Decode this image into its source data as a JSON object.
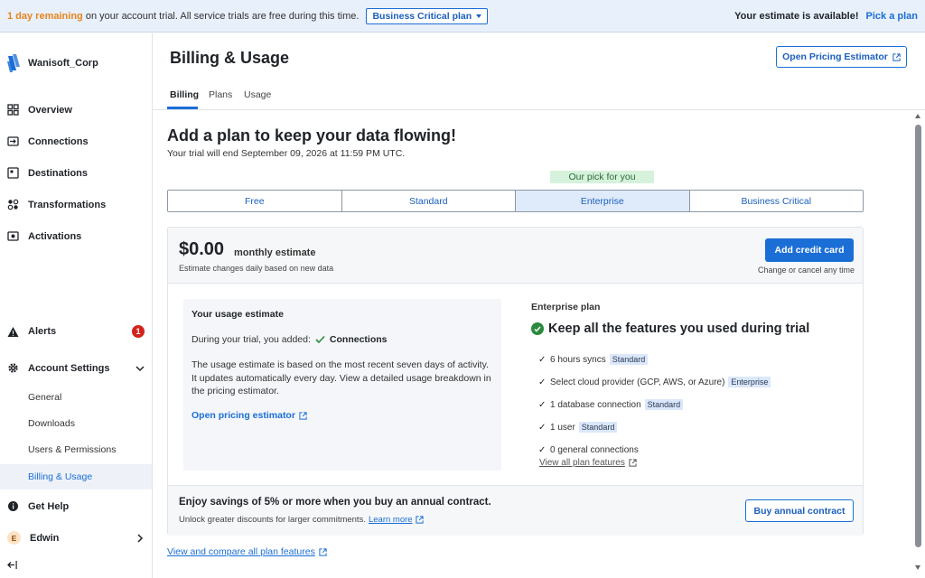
{
  "banner": {
    "days_remaining": "1 day remaining",
    "trial_text": " on your account trial. All service trials are free during this time.",
    "plan_select": "Business Critical plan",
    "estimate_text": "Your estimate is available!",
    "pick_plan": "Pick a plan"
  },
  "sidebar": {
    "org_name": "Wanisoft_Corp",
    "items": [
      {
        "label": "Overview",
        "icon": "grid-icon"
      },
      {
        "label": "Connections",
        "icon": "connections-icon"
      },
      {
        "label": "Destinations",
        "icon": "destinations-icon"
      },
      {
        "label": "Transformations",
        "icon": "transformations-icon"
      },
      {
        "label": "Activations",
        "icon": "activations-icon"
      }
    ],
    "alerts_label": "Alerts",
    "alerts_count": "1",
    "account_settings_label": "Account Settings",
    "sub_items": [
      "General",
      "Downloads",
      "Users & Permissions",
      "Billing & Usage"
    ],
    "help_label": "Get Help",
    "user_initial": "E",
    "user_name": "Edwin"
  },
  "header": {
    "title": "Billing & Usage",
    "pricing_button": "Open Pricing Estimator"
  },
  "tabs": [
    "Billing",
    "Plans",
    "Usage"
  ],
  "main": {
    "headline": "Add a plan to keep your data flowing!",
    "trial_end": "Your trial will end September 09, 2026 at 11:59 PM UTC.",
    "our_pick": "Our pick for you",
    "plans": [
      "Free",
      "Standard",
      "Enterprise",
      "Business Critical"
    ],
    "selected_plan": "Enterprise"
  },
  "estimate": {
    "price": "$0.00",
    "monthly": "monthly estimate",
    "note": "Estimate changes daily based on new data",
    "add_card": "Add credit card",
    "cancel_note": "Change or cancel any time"
  },
  "usage": {
    "title": "Your usage estimate",
    "added_prefix": "During your trial, you added:",
    "added_item": "Connections",
    "description": "The usage estimate is based on the most recent seven days of activity. It updates automatically every day. View a detailed usage breakdown in the pricing estimator.",
    "link": "Open pricing estimator"
  },
  "enterprise": {
    "label": "Enterprise plan",
    "headline": "Keep all the features you used during trial",
    "features": [
      {
        "text": "6 hours syncs",
        "tag": "Standard"
      },
      {
        "text": "Select cloud provider (GCP, AWS, or Azure)",
        "tag": "Enterprise"
      },
      {
        "text": "1 database connection",
        "tag": "Standard"
      },
      {
        "text": "1 user",
        "tag": "Standard"
      },
      {
        "text": "0 general connections",
        "tag": ""
      }
    ],
    "view_all": "View all plan features"
  },
  "annual": {
    "title": "Enjoy savings of 5% or more when you buy an annual contract.",
    "note": "Unlock greater discounts for larger commitments.",
    "learn_more": "Learn more",
    "button": "Buy annual contract"
  },
  "compare_link": "View and compare all plan features",
  "colors": {
    "accent": "#1b6ed6",
    "warning": "#e8841a",
    "success": "#2a8a3e",
    "alert": "#d4231d"
  }
}
